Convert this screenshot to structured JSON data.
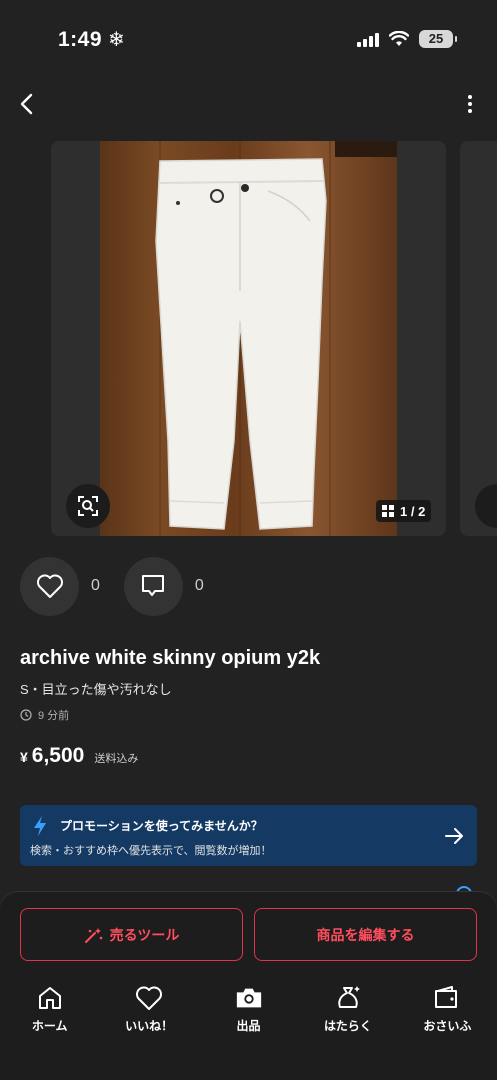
{
  "status_bar": {
    "time": "1:49",
    "weather_icon": "snowflake-icon",
    "battery": "25"
  },
  "gallery": {
    "counter": "1 / 2"
  },
  "actions": {
    "likes": "0",
    "comments": "0"
  },
  "item": {
    "title": "archive white skinny opium y2k",
    "condition": "S・目立った傷や汚れなし",
    "posted": "9 分前",
    "price_currency": "¥",
    "price": "6,500",
    "shipping": "送料込み"
  },
  "promo": {
    "title": "プロモーションを使ってみませんか？",
    "subtitle": "検索・おすすめ枠へ優先表示で、閲覧数が増加！"
  },
  "bottom_buttons": {
    "sell_tool": "売るツール",
    "edit_item": "商品を編集する"
  },
  "tabs": [
    {
      "label": "ホーム",
      "icon": "home-icon"
    },
    {
      "label": "いいね！",
      "icon": "heart-icon"
    },
    {
      "label": "出品",
      "icon": "camera-icon"
    },
    {
      "label": "はたらく",
      "icon": "money-bag-icon"
    },
    {
      "label": "おさいふ",
      "icon": "wallet-icon"
    }
  ],
  "colors": {
    "background": "#222222",
    "accent": "#e0344a",
    "promo": "#143a64"
  }
}
